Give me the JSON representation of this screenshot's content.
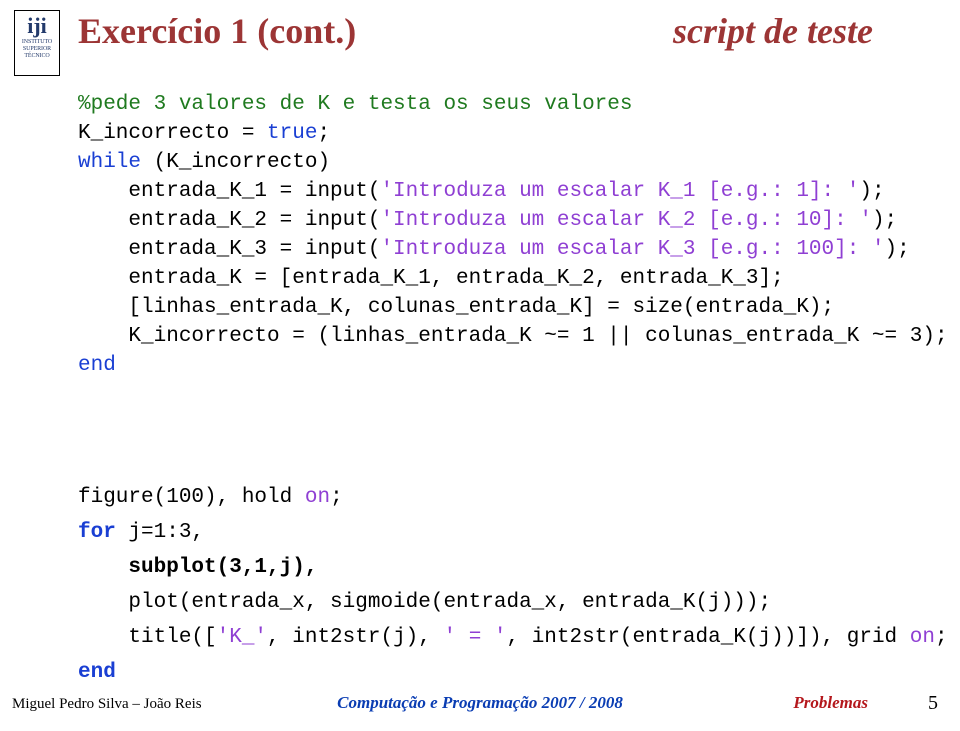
{
  "logo": {
    "abbr": "iji",
    "line1": "INSTITUTO",
    "line2": "SUPERIOR",
    "line3": "TÉCNICO"
  },
  "title": {
    "left": "Exercício 1 (cont.)",
    "right": "script de teste"
  },
  "code": {
    "l1": "%pede 3 valores de K e testa os seus valores",
    "l2a": "K_incorrecto = ",
    "l2b": "true",
    "l2c": ";",
    "l3a": "while",
    "l3b": " (K_incorrecto)",
    "l4a": "    entrada_K_1 = input(",
    "l4b": "'Introduza um escalar K_1 [e.g.: 1]: '",
    "l4c": ");",
    "l5a": "    entrada_K_2 = input(",
    "l5b": "'Introduza um escalar K_2 [e.g.: 10]: '",
    "l5c": ");",
    "l6a": "    entrada_K_3 = input(",
    "l6b": "'Introduza um escalar K_3 [e.g.: 100]: '",
    "l6c": ");",
    "l7": "    entrada_K = [entrada_K_1, entrada_K_2, entrada_K_3];",
    "l8": "    [linhas_entrada_K, colunas_entrada_K] = size(entrada_K);",
    "l9": "    K_incorrecto = (linhas_entrada_K ~= 1 || colunas_entrada_K ~= 3);",
    "l10": "end"
  },
  "code2": {
    "l1a": "figure(100), hold ",
    "l1b": "on",
    "l1c": ";",
    "l2a": "for",
    "l2b": " j=1:3,",
    "l3": "    subplot(3,1,j),",
    "l4": "    plot(entrada_x, sigmoide(entrada_x, entrada_K(j)));",
    "l5a": "    title([",
    "l5b": "'K_'",
    "l5c": ", int2str(j), ",
    "l5d": "' = '",
    "l5e": ", int2str(entrada_K(j))]), grid ",
    "l5f": "on",
    "l5g": ";",
    "l6": "end"
  },
  "footer": {
    "left": "Miguel Pedro Silva – João Reis",
    "center": "Computação e Programação 2007 / 2008",
    "right": "Problemas",
    "pagenum": "5"
  }
}
